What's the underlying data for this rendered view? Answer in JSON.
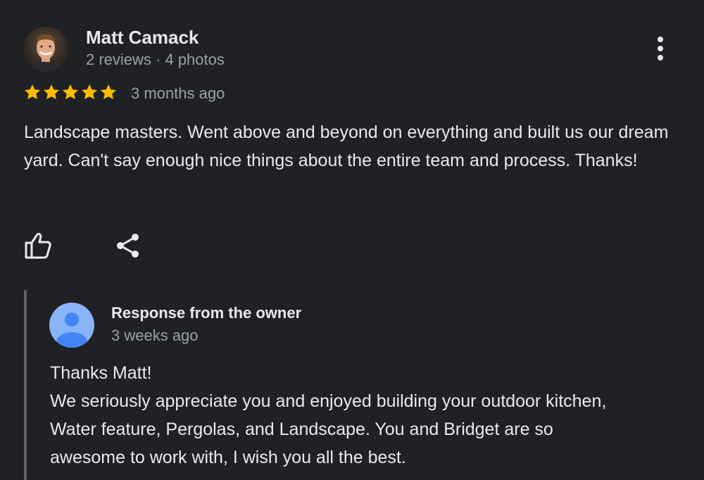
{
  "review": {
    "reviewer_name": "Matt Camack",
    "reviewer_meta": "2 reviews · 4 photos",
    "rating": 5,
    "rating_max": 5,
    "star_color": "#fbbc04",
    "time": "3 months ago",
    "text": "Landscape masters. Went above and beyond on everything and built us our dream yard. Can't say enough nice things about the entire team and process. Thanks!",
    "actions": {
      "like_icon": "thumbs-up-icon",
      "share_icon": "share-icon",
      "more_icon": "more-vert-icon"
    }
  },
  "owner_response": {
    "title": "Response from the owner",
    "time": "3 weeks ago",
    "avatar_icon": "person-icon",
    "avatar_color": "#8ab4f8",
    "lines": [
      "Thanks Matt!",
      "We seriously appreciate you and enjoyed building your outdoor kitchen,",
      "Water feature, Pergolas, and Landscape. You and Bridget are so",
      "awesome to work with, I wish you all the best."
    ]
  }
}
